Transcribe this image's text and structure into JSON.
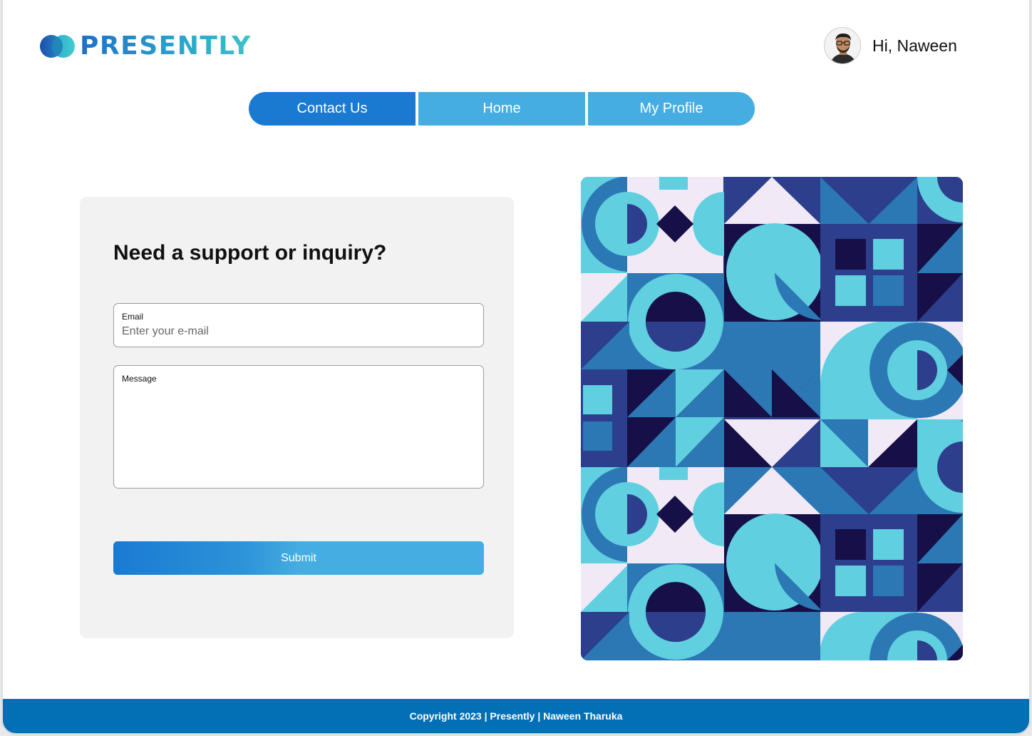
{
  "brand": {
    "name": "PRESENTLY",
    "logo_icon": "overlapping-circles-logo-icon"
  },
  "user": {
    "greeting": "Hi, Naween",
    "avatar_icon": "user-avatar"
  },
  "nav": {
    "tabs": [
      {
        "label": "Contact Us",
        "active": true
      },
      {
        "label": "Home",
        "active": false
      },
      {
        "label": "My Profile",
        "active": false
      }
    ]
  },
  "form": {
    "title": "Need a support or inquiry?",
    "email": {
      "label": "Email",
      "placeholder": "Enter your e-mail",
      "value": ""
    },
    "message": {
      "label": "Message",
      "value": ""
    },
    "submit_label": "Submit"
  },
  "footer": {
    "text": "Copyright 2023 | Presently | Naween Tharuka"
  },
  "colors": {
    "primary": "#1a7ad2",
    "secondary": "#45ade1",
    "footer": "#0370b6",
    "pattern_navy": "#170f47",
    "pattern_indigo": "#2c3e8c",
    "pattern_blue": "#2b78b5",
    "pattern_cyan": "#60cfdf",
    "pattern_lavender": "#f1e9f5"
  }
}
